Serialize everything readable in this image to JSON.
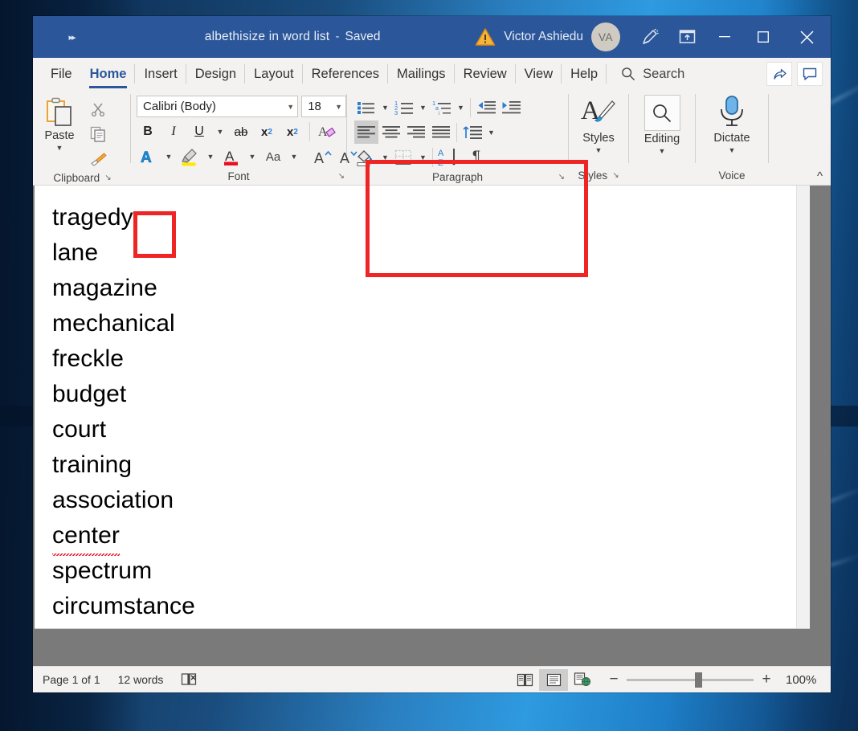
{
  "window": {
    "title_name": "albethisize in word list",
    "title_separator": "-",
    "title_status": "Saved",
    "qat_icon": "quick-access-chevrons-icon",
    "warning_icon": "warning-triangle-icon",
    "user_name": "Victor Ashiedu",
    "user_initials": "VA",
    "ink_icon": "ink-pen-icon",
    "present_icon": "present-online-icon",
    "minimize_label": "—",
    "maximize_label": "□",
    "close_label": "✕",
    "accent_color": "#2b579a"
  },
  "tabs": [
    {
      "label": "File",
      "active": false
    },
    {
      "label": "Home",
      "active": true
    },
    {
      "label": "Insert",
      "active": false
    },
    {
      "label": "Design",
      "active": false
    },
    {
      "label": "Layout",
      "active": false
    },
    {
      "label": "References",
      "active": false
    },
    {
      "label": "Mailings",
      "active": false
    },
    {
      "label": "Review",
      "active": false
    },
    {
      "label": "View",
      "active": false
    },
    {
      "label": "Help",
      "active": false
    }
  ],
  "search": {
    "label": "Search",
    "icon": "search-icon"
  },
  "tabs_right": [
    {
      "name": "share-button",
      "icon": "share-icon"
    },
    {
      "name": "comments-button",
      "icon": "comment-bubble-icon"
    }
  ],
  "ribbon": {
    "clipboard": {
      "group_label": "Clipboard",
      "paste_label": "Paste",
      "paste_icon": "paste-clipboard-icon",
      "cut_icon": "scissors-icon",
      "copy_icon": "copy-icon",
      "format_painter_icon": "format-painter-icon",
      "dialog_launcher": "↘"
    },
    "font": {
      "group_label": "Font",
      "font_name": "Calibri (Body)",
      "font_size": "18",
      "bold_label": "B",
      "italic_label": "I",
      "underline_label": "U",
      "strikethrough_label": "ab",
      "subscript_label": "x",
      "subscript_sub": "2",
      "superscript_label": "x",
      "superscript_sup": "2",
      "clear_formatting_icon": "clear-formatting-icon",
      "text_effects_label": "A",
      "highlight_label": "highlight-color-icon",
      "font_color_label": "A",
      "change_case_label": "Aa",
      "grow_font_label": "A",
      "shrink_font_label": "A",
      "dialog_launcher": "↘"
    },
    "paragraph": {
      "group_label": "Paragraph",
      "bullets_icon": "bullet-list-icon",
      "numbering_icon": "numbered-list-icon",
      "multilevel_icon": "multilevel-list-icon",
      "decrease_indent_icon": "decrease-indent-icon",
      "increase_indent_icon": "increase-indent-icon",
      "align_left_icon": "align-left-icon",
      "align_center_icon": "align-center-icon",
      "align_right_icon": "align-right-icon",
      "justify_icon": "justify-icon",
      "line_spacing_icon": "line-spacing-icon",
      "shading_icon": "shading-icon",
      "borders_icon": "borders-icon",
      "sort_icon": "sort-az-icon",
      "show_marks_label": "¶",
      "dialog_launcher": "↘"
    },
    "styles": {
      "group_label": "Styles",
      "button_label": "Styles",
      "icon": "styles-brush-icon",
      "dialog_launcher": "↘"
    },
    "editing": {
      "button_label": "Editing",
      "icon": "magnifier-icon"
    },
    "voice": {
      "group_label": "Voice",
      "button_label": "Dictate",
      "icon": "microphone-icon"
    },
    "collapse_icon": "collapse-ribbon-chevron-icon"
  },
  "annotations": [
    {
      "name": "paragraph-group-highlight",
      "color": "#ef2424"
    },
    {
      "name": "sort-button-highlight",
      "color": "#ef2424"
    }
  ],
  "document": {
    "lines": [
      {
        "text": "tragedy",
        "misspelled": false
      },
      {
        "text": "lane",
        "misspelled": false
      },
      {
        "text": "magazine",
        "misspelled": false
      },
      {
        "text": "mechanical",
        "misspelled": false
      },
      {
        "text": "freckle",
        "misspelled": false
      },
      {
        "text": "budget",
        "misspelled": false
      },
      {
        "text": "court",
        "misspelled": false
      },
      {
        "text": "training",
        "misspelled": false
      },
      {
        "text": "association",
        "misspelled": false
      },
      {
        "text": "center",
        "misspelled": true
      },
      {
        "text": "spectrum",
        "misspelled": false
      },
      {
        "text": "circumstance",
        "misspelled": false
      }
    ]
  },
  "statusbar": {
    "page_label": "Page 1 of 1",
    "word_count": "12 words",
    "proofing_icon": "proofing-errors-icon",
    "views": [
      {
        "name": "read-mode-view",
        "icon": "read-mode-icon",
        "active": false
      },
      {
        "name": "print-layout-view",
        "icon": "print-layout-icon",
        "active": true
      },
      {
        "name": "web-layout-view",
        "icon": "web-layout-icon",
        "active": false
      }
    ],
    "zoom_out": "−",
    "zoom_in": "+",
    "zoom_value": "100%"
  }
}
